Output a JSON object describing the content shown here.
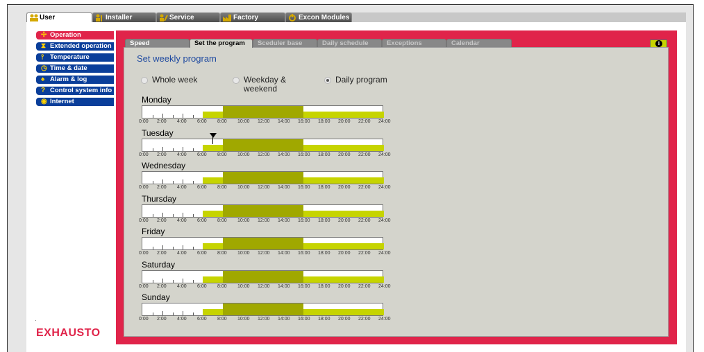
{
  "top_tabs": [
    {
      "label": "User",
      "icon": "users-icon",
      "active": true
    },
    {
      "label": "Installer",
      "icon": "installer-icon",
      "active": false
    },
    {
      "label": "Service",
      "icon": "service-icon",
      "active": false
    },
    {
      "label": "Factory",
      "icon": "factory-icon",
      "active": false
    },
    {
      "label": "Excon Modules",
      "icon": "modules-icon",
      "active": false
    }
  ],
  "sidebar": {
    "items": [
      {
        "label": "Operation",
        "icon": "fan-icon",
        "active": true
      },
      {
        "label": "Extended operation",
        "icon": "hourglass-icon",
        "active": false
      },
      {
        "label": "Temperature",
        "icon": "thermometer-icon",
        "active": false
      },
      {
        "label": "Time & date",
        "icon": "clock-icon",
        "active": false
      },
      {
        "label": "Alarm & log",
        "icon": "bell-icon",
        "active": false
      },
      {
        "label": "Control system info",
        "icon": "question-icon",
        "active": false
      },
      {
        "label": "Internet",
        "icon": "globe-icon",
        "active": false
      }
    ]
  },
  "sub_tabs": [
    {
      "label": "Speed",
      "enabled": true,
      "active": false
    },
    {
      "label": "Set the program",
      "enabled": true,
      "active": true
    },
    {
      "label": "Sceduler base",
      "enabled": false,
      "active": false
    },
    {
      "label": "Daily schedule",
      "enabled": false,
      "active": false
    },
    {
      "label": "Exceptions",
      "enabled": false,
      "active": false
    },
    {
      "label": "Calendar",
      "enabled": false,
      "active": false
    }
  ],
  "info_button": {
    "icon": "info-icon",
    "label": "i"
  },
  "content": {
    "heading": "Set weekly program",
    "radio_options": [
      {
        "label": "Whole week",
        "selected": false
      },
      {
        "label": "Weekday & weekend",
        "selected": false
      },
      {
        "label": "Daily program",
        "selected": true
      }
    ],
    "time_labels": [
      "0:00",
      "2:00",
      "4:00",
      "6:00",
      "8:00",
      "10:00",
      "12:00",
      "14:00",
      "16:00",
      "18:00",
      "20:00",
      "22:00",
      "24:00"
    ],
    "days": [
      {
        "name": "Monday"
      },
      {
        "name": "Tuesday"
      },
      {
        "name": "Wednesday"
      },
      {
        "name": "Thursday"
      },
      {
        "name": "Friday"
      },
      {
        "name": "Saturday"
      },
      {
        "name": "Sunday"
      }
    ],
    "schedule_colors": {
      "low": "#c6d400",
      "high": "#a0a800",
      "off": "#ffffff"
    },
    "schedule_hours": {
      "low_start": 6,
      "high_start": 8,
      "high_end": 16,
      "low_end": 24
    },
    "current_time_marker_hour": 7
  },
  "brand": {
    "logo_text": "EXHAUSTO",
    "accent": "#e0244a",
    "nav_color": "#0a3e9a"
  }
}
